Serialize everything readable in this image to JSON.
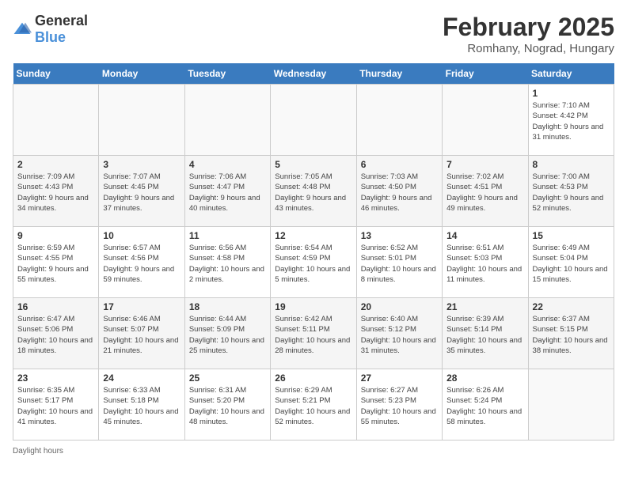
{
  "logo": {
    "general": "General",
    "blue": "Blue"
  },
  "title": "February 2025",
  "subtitle": "Romhany, Nograd, Hungary",
  "headers": [
    "Sunday",
    "Monday",
    "Tuesday",
    "Wednesday",
    "Thursday",
    "Friday",
    "Saturday"
  ],
  "weeks": [
    [
      {
        "day": "",
        "info": ""
      },
      {
        "day": "",
        "info": ""
      },
      {
        "day": "",
        "info": ""
      },
      {
        "day": "",
        "info": ""
      },
      {
        "day": "",
        "info": ""
      },
      {
        "day": "",
        "info": ""
      },
      {
        "day": "1",
        "info": "Sunrise: 7:10 AM\nSunset: 4:42 PM\nDaylight: 9 hours and 31 minutes."
      }
    ],
    [
      {
        "day": "2",
        "info": "Sunrise: 7:09 AM\nSunset: 4:43 PM\nDaylight: 9 hours and 34 minutes."
      },
      {
        "day": "3",
        "info": "Sunrise: 7:07 AM\nSunset: 4:45 PM\nDaylight: 9 hours and 37 minutes."
      },
      {
        "day": "4",
        "info": "Sunrise: 7:06 AM\nSunset: 4:47 PM\nDaylight: 9 hours and 40 minutes."
      },
      {
        "day": "5",
        "info": "Sunrise: 7:05 AM\nSunset: 4:48 PM\nDaylight: 9 hours and 43 minutes."
      },
      {
        "day": "6",
        "info": "Sunrise: 7:03 AM\nSunset: 4:50 PM\nDaylight: 9 hours and 46 minutes."
      },
      {
        "day": "7",
        "info": "Sunrise: 7:02 AM\nSunset: 4:51 PM\nDaylight: 9 hours and 49 minutes."
      },
      {
        "day": "8",
        "info": "Sunrise: 7:00 AM\nSunset: 4:53 PM\nDaylight: 9 hours and 52 minutes."
      }
    ],
    [
      {
        "day": "9",
        "info": "Sunrise: 6:59 AM\nSunset: 4:55 PM\nDaylight: 9 hours and 55 minutes."
      },
      {
        "day": "10",
        "info": "Sunrise: 6:57 AM\nSunset: 4:56 PM\nDaylight: 9 hours and 59 minutes."
      },
      {
        "day": "11",
        "info": "Sunrise: 6:56 AM\nSunset: 4:58 PM\nDaylight: 10 hours and 2 minutes."
      },
      {
        "day": "12",
        "info": "Sunrise: 6:54 AM\nSunset: 4:59 PM\nDaylight: 10 hours and 5 minutes."
      },
      {
        "day": "13",
        "info": "Sunrise: 6:52 AM\nSunset: 5:01 PM\nDaylight: 10 hours and 8 minutes."
      },
      {
        "day": "14",
        "info": "Sunrise: 6:51 AM\nSunset: 5:03 PM\nDaylight: 10 hours and 11 minutes."
      },
      {
        "day": "15",
        "info": "Sunrise: 6:49 AM\nSunset: 5:04 PM\nDaylight: 10 hours and 15 minutes."
      }
    ],
    [
      {
        "day": "16",
        "info": "Sunrise: 6:47 AM\nSunset: 5:06 PM\nDaylight: 10 hours and 18 minutes."
      },
      {
        "day": "17",
        "info": "Sunrise: 6:46 AM\nSunset: 5:07 PM\nDaylight: 10 hours and 21 minutes."
      },
      {
        "day": "18",
        "info": "Sunrise: 6:44 AM\nSunset: 5:09 PM\nDaylight: 10 hours and 25 minutes."
      },
      {
        "day": "19",
        "info": "Sunrise: 6:42 AM\nSunset: 5:11 PM\nDaylight: 10 hours and 28 minutes."
      },
      {
        "day": "20",
        "info": "Sunrise: 6:40 AM\nSunset: 5:12 PM\nDaylight: 10 hours and 31 minutes."
      },
      {
        "day": "21",
        "info": "Sunrise: 6:39 AM\nSunset: 5:14 PM\nDaylight: 10 hours and 35 minutes."
      },
      {
        "day": "22",
        "info": "Sunrise: 6:37 AM\nSunset: 5:15 PM\nDaylight: 10 hours and 38 minutes."
      }
    ],
    [
      {
        "day": "23",
        "info": "Sunrise: 6:35 AM\nSunset: 5:17 PM\nDaylight: 10 hours and 41 minutes."
      },
      {
        "day": "24",
        "info": "Sunrise: 6:33 AM\nSunset: 5:18 PM\nDaylight: 10 hours and 45 minutes."
      },
      {
        "day": "25",
        "info": "Sunrise: 6:31 AM\nSunset: 5:20 PM\nDaylight: 10 hours and 48 minutes."
      },
      {
        "day": "26",
        "info": "Sunrise: 6:29 AM\nSunset: 5:21 PM\nDaylight: 10 hours and 52 minutes."
      },
      {
        "day": "27",
        "info": "Sunrise: 6:27 AM\nSunset: 5:23 PM\nDaylight: 10 hours and 55 minutes."
      },
      {
        "day": "28",
        "info": "Sunrise: 6:26 AM\nSunset: 5:24 PM\nDaylight: 10 hours and 58 minutes."
      },
      {
        "day": "",
        "info": ""
      }
    ]
  ],
  "footer": "Daylight hours"
}
